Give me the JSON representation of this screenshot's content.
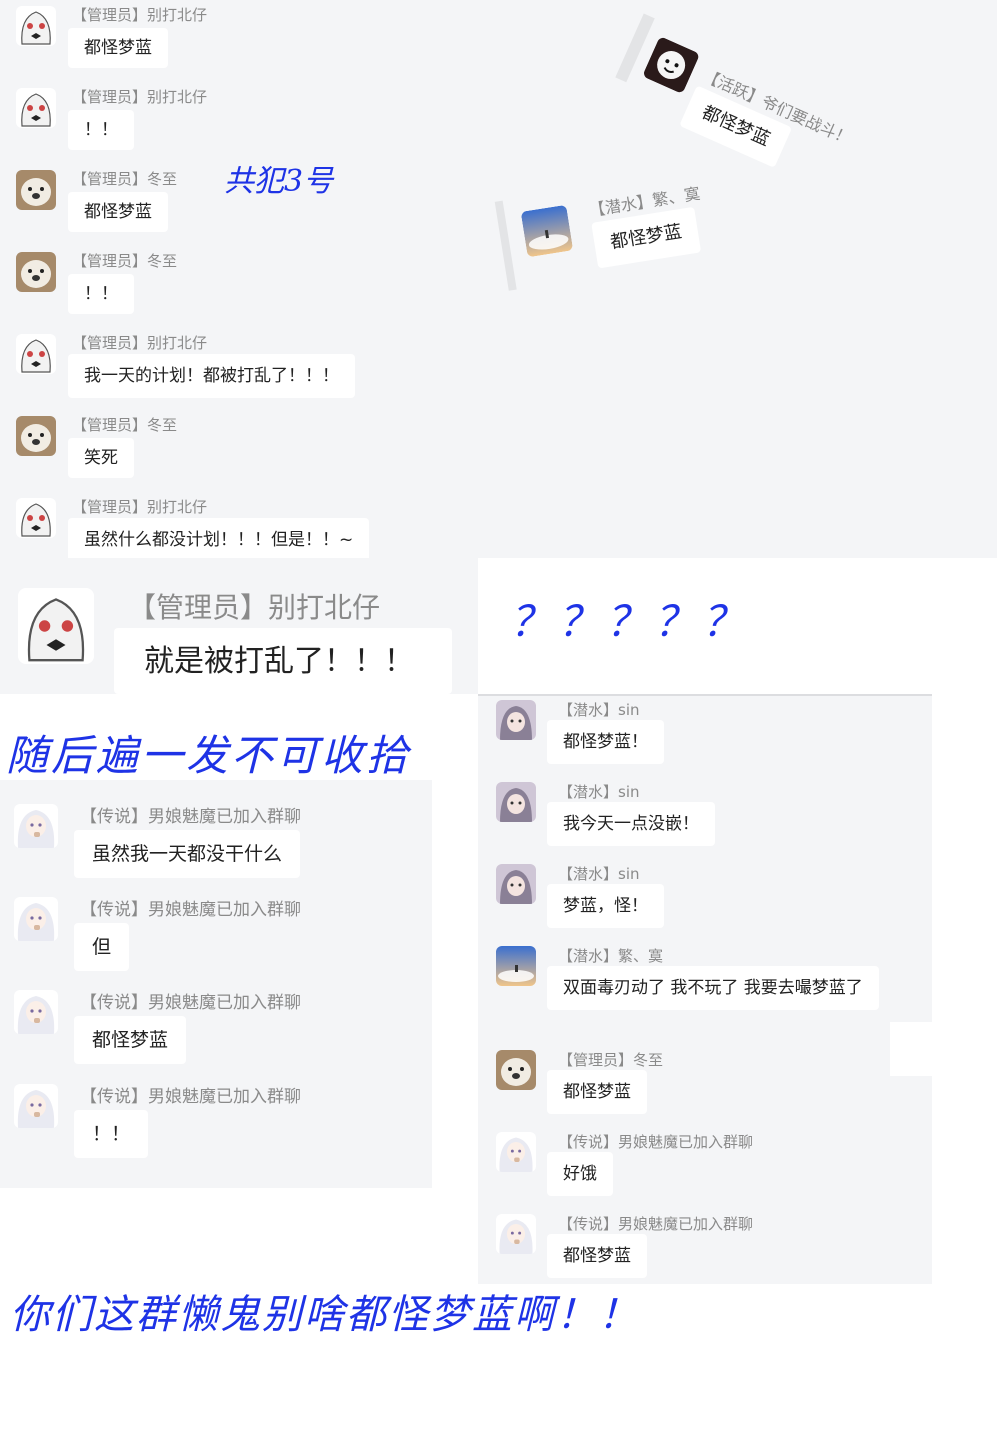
{
  "panel1": {
    "messages": [
      {
        "tag": "【管理员】",
        "name": "别打北仔",
        "text": "都怪梦蓝",
        "avatar": "ghost-girl-icon"
      },
      {
        "tag": "【管理员】",
        "name": "别打北仔",
        "text": "！！",
        "avatar": "ghost-girl-icon"
      },
      {
        "tag": "【管理员】",
        "name": "冬至",
        "text": "都怪梦蓝",
        "avatar": "seal-icon"
      },
      {
        "tag": "【管理员】",
        "name": "冬至",
        "text": "！！",
        "avatar": "seal-icon"
      },
      {
        "tag": "【管理员】",
        "name": "别打北仔",
        "text": "我一天的计划！都被打乱了！！！",
        "avatar": "ghost-girl-icon"
      },
      {
        "tag": "【管理员】",
        "name": "冬至",
        "text": "笑死",
        "avatar": "seal-icon"
      },
      {
        "tag": "【管理员】",
        "name": "别打北仔",
        "text": "虽然什么都没计划！！！但是！！~",
        "avatar": "ghost-girl-icon"
      }
    ],
    "annotation": "共犯3号"
  },
  "tilted": {
    "active": {
      "tag": "【活跃】",
      "name": "爷们要战斗！",
      "text": "都怪梦蓝"
    },
    "diving": {
      "tag": "【潜水】",
      "name": "繁、寞",
      "text": "都怪梦蓝"
    }
  },
  "zoom": {
    "tag": "【管理员】",
    "name": "别打北仔",
    "text": "就是被打乱了！！！"
  },
  "question_marks": "？？？？？",
  "caption_middle": "随后遍一发不可收拾",
  "panel_left": {
    "messages": [
      {
        "tag": "【传说】",
        "name": "男娘魅魔已加入群聊",
        "text": "虽然我一天都没干什么"
      },
      {
        "tag": "【传说】",
        "name": "男娘魅魔已加入群聊",
        "text": "但"
      },
      {
        "tag": "【传说】",
        "name": "男娘魅魔已加入群聊",
        "text": "都怪梦蓝"
      },
      {
        "tag": "【传说】",
        "name": "男娘魅魔已加入群聊",
        "text": "！！"
      }
    ]
  },
  "panel_right": {
    "messages": [
      {
        "tag": "【潜水】",
        "name": "sin",
        "text": "都怪梦蓝！",
        "avatar": "anime-girl-icon"
      },
      {
        "tag": "【潜水】",
        "name": "sin",
        "text": "我今天一点没嵌！",
        "avatar": "anime-girl-icon"
      },
      {
        "tag": "【潜水】",
        "name": "sin",
        "text": "梦蓝，怪！",
        "avatar": "anime-girl-icon"
      },
      {
        "tag": "【潜水】",
        "name": "繁、寞",
        "text": "双面毒刃动了 我不玩了 我要去嘬梦蓝了",
        "avatar": "sky-icon"
      },
      {
        "tag": "【管理员】",
        "name": "冬至",
        "text": "都怪梦蓝",
        "avatar": "seal-icon"
      },
      {
        "tag": "【传说】",
        "name": "男娘魅魔已加入群聊",
        "text": "好饿",
        "avatar": "white-hair-girl-icon"
      },
      {
        "tag": "【传说】",
        "name": "男娘魅魔已加入群聊",
        "text": "都怪梦蓝",
        "avatar": "white-hair-girl-icon"
      }
    ]
  },
  "caption_bottom": "你们这群懒鬼别啥都怪梦蓝啊！！"
}
